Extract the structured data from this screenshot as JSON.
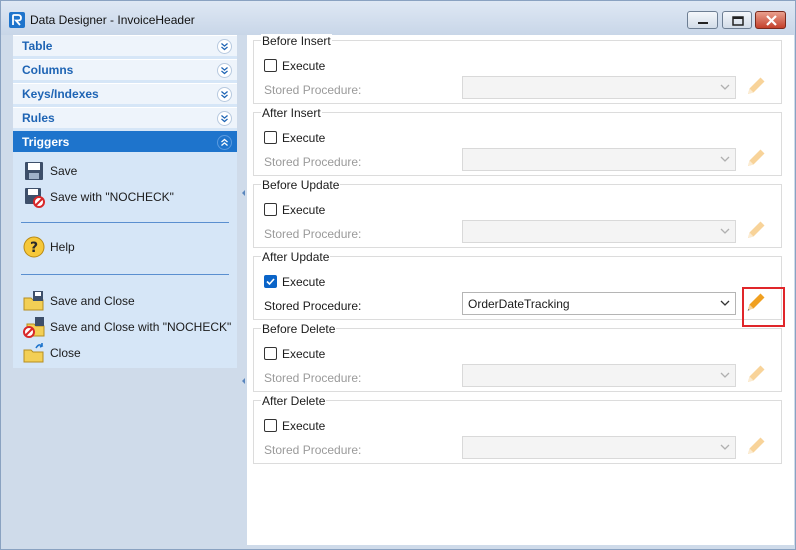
{
  "window": {
    "title": "Data Designer - InvoiceHeader"
  },
  "sidebar": {
    "sections": [
      {
        "label": "Table",
        "expanded": false
      },
      {
        "label": "Columns",
        "expanded": false
      },
      {
        "label": "Keys/Indexes",
        "expanded": false
      },
      {
        "label": "Rules",
        "expanded": false
      },
      {
        "label": "Triggers",
        "expanded": true
      }
    ],
    "commands": {
      "save": "Save",
      "save_nocheck": "Save with \"NOCHECK\"",
      "help": "Help",
      "save_close": "Save and Close",
      "save_close_nocheck": "Save and Close with \"NOCHECK\"",
      "close": "Close"
    }
  },
  "triggers": [
    {
      "title": "Before Insert",
      "execute_label": "Execute",
      "execute": false,
      "sp_label": "Stored Procedure:",
      "sp_value": ""
    },
    {
      "title": "After Insert",
      "execute_label": "Execute",
      "execute": false,
      "sp_label": "Stored Procedure:",
      "sp_value": ""
    },
    {
      "title": "Before Update",
      "execute_label": "Execute",
      "execute": false,
      "sp_label": "Stored Procedure:",
      "sp_value": ""
    },
    {
      "title": "After Update",
      "execute_label": "Execute",
      "execute": true,
      "sp_label": "Stored Procedure:",
      "sp_value": "OrderDateTracking"
    },
    {
      "title": "Before Delete",
      "execute_label": "Execute",
      "execute": false,
      "sp_label": "Stored Procedure:",
      "sp_value": ""
    },
    {
      "title": "After Delete",
      "execute_label": "Execute",
      "execute": false,
      "sp_label": "Stored Procedure:",
      "sp_value": ""
    }
  ],
  "colors": {
    "accent": "#1e74cc",
    "highlight": "#e0262a",
    "pencil": "#f0a020"
  }
}
